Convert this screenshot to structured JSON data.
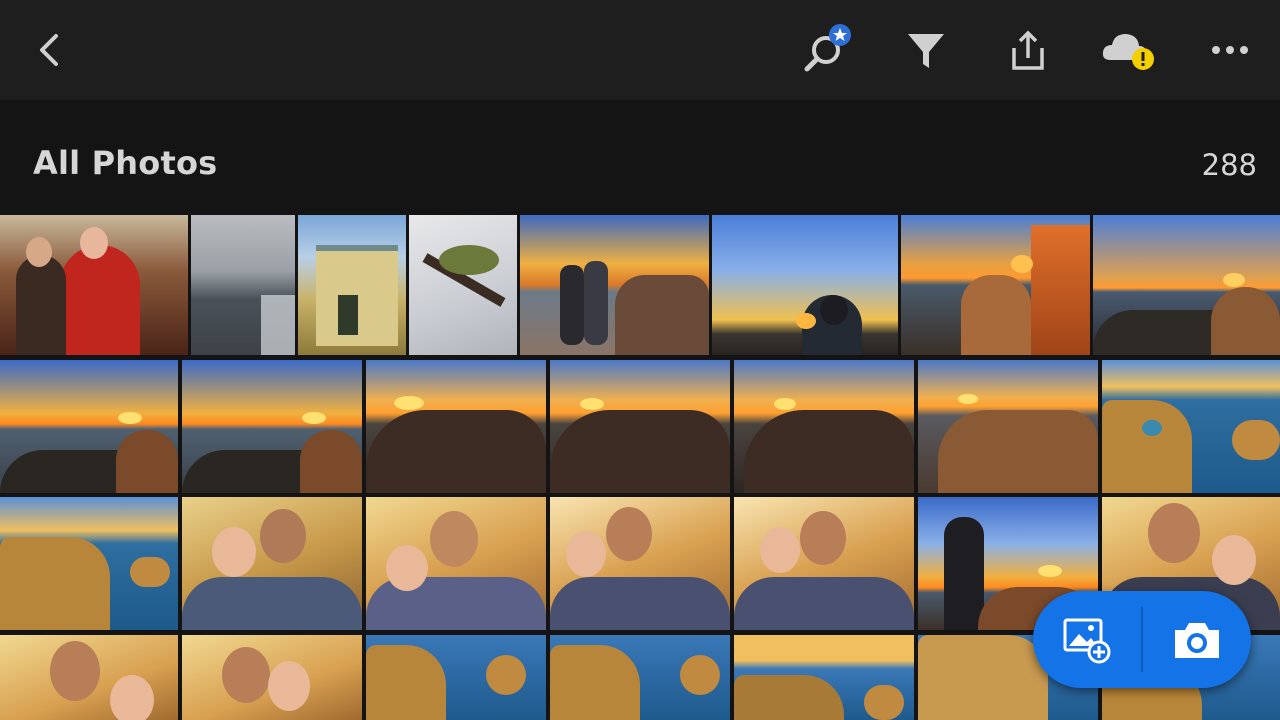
{
  "topbar": {
    "icons": [
      "back-arrow-icon",
      "search-star-icon",
      "filter-funnel-icon",
      "share-upload-icon",
      "cloud-warning-icon",
      "more-dots-icon"
    ]
  },
  "header": {
    "title": "All Photos",
    "count": "288"
  },
  "colors": {
    "accent": "#1473e6",
    "toolbar_bg": "#1e1e1e",
    "badge_blue": "#2d6fd6",
    "warning_yellow": "#f5d000"
  },
  "fab": {
    "icons": [
      "add-photo-icon",
      "camera-icon"
    ]
  }
}
